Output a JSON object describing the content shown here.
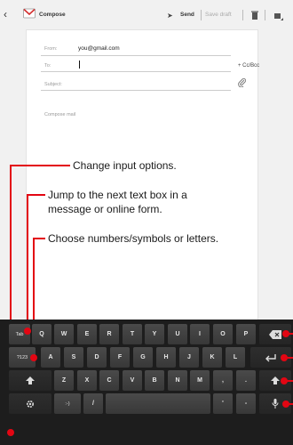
{
  "header": {
    "title": "Compose",
    "send_label": "Send",
    "save_draft_label": "Save draft"
  },
  "compose": {
    "from_label": "From:",
    "from_value": "you@gmail.com",
    "to_label": "To:",
    "cc_bcc_label": "+ Cc/Bcc",
    "subject_label": "Subject:",
    "body_placeholder": "Compose mail"
  },
  "callouts": {
    "input_options": "Change input options.",
    "next_box_line1": "Jump to the next text box in a",
    "next_box_line2": "message or online form.",
    "numbers_symbols": "Choose numbers/symbols or letters."
  },
  "keyboard": {
    "row1": [
      "Tab",
      "Q",
      "W",
      "E",
      "R",
      "T",
      "Y",
      "U",
      "I",
      "O",
      "P"
    ],
    "row2": [
      "?123",
      "A",
      "S",
      "D",
      "F",
      "G",
      "H",
      "J",
      "K",
      "L"
    ],
    "row3": [
      "Z",
      "X",
      "C",
      "V",
      "B",
      "N",
      "M",
      ",",
      "."
    ],
    "row4": [
      ":-)",
      "/",
      "'",
      "-"
    ]
  },
  "colors": {
    "callout_line": "#e30613",
    "keyboard_bg": "#1d1d1d",
    "key": "#404040"
  }
}
